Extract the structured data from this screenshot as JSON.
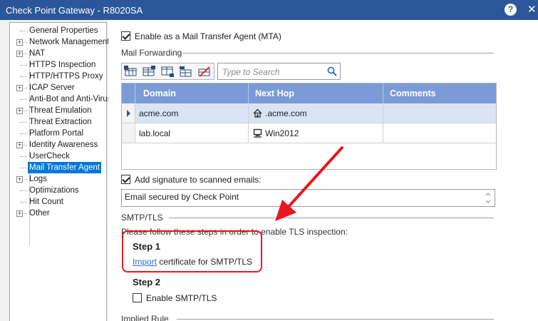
{
  "window": {
    "title": "Check Point Gateway - R8020SA",
    "help_glyph": "?",
    "close_glyph": "✕"
  },
  "sidebar": {
    "items": [
      {
        "label": "General Properties",
        "expandable": false,
        "selected": false
      },
      {
        "label": "Network Management",
        "expandable": true,
        "selected": false
      },
      {
        "label": "NAT",
        "expandable": true,
        "selected": false
      },
      {
        "label": "HTTPS Inspection",
        "expandable": false,
        "selected": false
      },
      {
        "label": "HTTP/HTTPS Proxy",
        "expandable": false,
        "selected": false
      },
      {
        "label": "ICAP Server",
        "expandable": true,
        "selected": false
      },
      {
        "label": "Anti-Bot and Anti-Virus",
        "expandable": false,
        "selected": false
      },
      {
        "label": "Threat Emulation",
        "expandable": true,
        "selected": false
      },
      {
        "label": "Threat Extraction",
        "expandable": false,
        "selected": false
      },
      {
        "label": "Platform Portal",
        "expandable": false,
        "selected": false
      },
      {
        "label": "Identity Awareness",
        "expandable": true,
        "selected": false
      },
      {
        "label": "UserCheck",
        "expandable": false,
        "selected": false
      },
      {
        "label": "Mail Transfer Agent",
        "expandable": false,
        "selected": true
      },
      {
        "label": "Logs",
        "expandable": true,
        "selected": false
      },
      {
        "label": "Optimizations",
        "expandable": false,
        "selected": false
      },
      {
        "label": "Hit Count",
        "expandable": false,
        "selected": false
      },
      {
        "label": "Other",
        "expandable": true,
        "selected": false
      }
    ],
    "toggle_glyph": "+"
  },
  "main": {
    "mta_checkbox": {
      "label": "Enable as a Mail Transfer Agent (MTA)",
      "checked": true
    },
    "mail_forwarding": {
      "section_title": "Mail Forwarding",
      "toolbar_icons": [
        "add-row-icon",
        "add-above-icon",
        "add-below-icon",
        "edit-row-icon",
        "delete-row-icon"
      ],
      "search": {
        "placeholder": "Type to Search",
        "value": ""
      },
      "table": {
        "columns": [
          "Domain",
          "Next Hop",
          "Comments"
        ],
        "rows": [
          {
            "domain": "acme.com",
            "next_hop": ".acme.com",
            "next_hop_icon": "house-icon",
            "comments": "",
            "selected": true
          },
          {
            "domain": "lab.local",
            "next_hop": "Win2012",
            "next_hop_icon": "computer-icon",
            "comments": "",
            "selected": false
          }
        ]
      }
    },
    "signature": {
      "checkbox_label": "Add signature to scanned emails:",
      "checked": true,
      "value": "Email secured by Check Point"
    },
    "smtp_tls": {
      "section_title": "SMTP/TLS",
      "instructions": "Please follow these steps in order to enable TLS inspection:",
      "step1": {
        "title": "Step 1",
        "link_text": "Import",
        "rest_text": " certificate for SMTP/TLS"
      },
      "step2": {
        "title": "Step 2",
        "checkbox_label": "Enable SMTP/TLS",
        "checked": false
      }
    },
    "implied_rule": {
      "section_title": "Implied Rule"
    }
  },
  "colors": {
    "titlebar": "#2b579a",
    "grid_header": "#7a9bd6",
    "selection": "#0078d7",
    "annotation": "#e8171f",
    "link": "#2f6fca"
  }
}
